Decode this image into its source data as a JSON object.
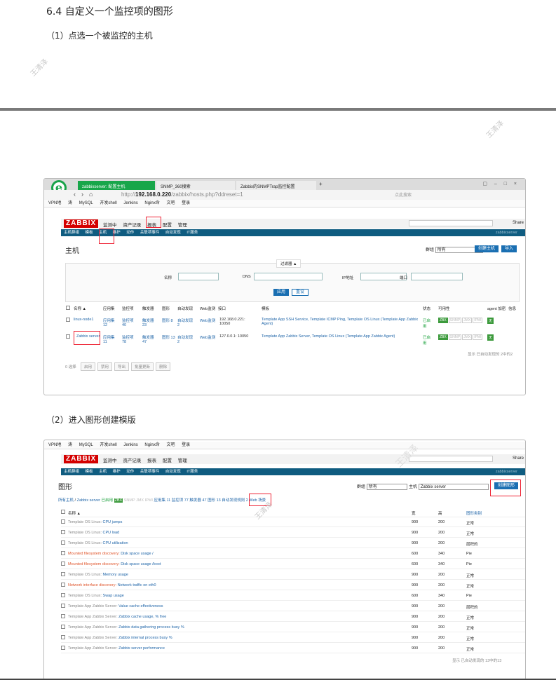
{
  "doc": {
    "heading": "6.4   自定义一个监控项的图形",
    "step1": "（1）点选一个被监控的主机",
    "step2": "（2）进入图形创建模版",
    "watermark": "王清泽"
  },
  "shot1": {
    "browser": {
      "tabs": [
        "zabbixserver: 配置主机",
        "SNMP_360搜索",
        "Zabbix的SNMPTrap监控配置"
      ],
      "url_prefix": "http://",
      "url_host": "192.168.0.220",
      "url_path": "/zabbix/hosts.php?ddreset=1",
      "search_placeholder": "点此搜索",
      "bookmarks": [
        "VPN地",
        "涛",
        "MySQL",
        "开发shell",
        "Jenkins",
        "Nginx命",
        "文吧",
        "登录"
      ]
    },
    "zabbix": {
      "logo": "ZABBIX",
      "menu": [
        "监测中",
        "资产记录",
        "报表",
        "配置",
        "管理"
      ],
      "share": "Share",
      "submenu": [
        "主机群组",
        "模板",
        "主机",
        "维护",
        "动作",
        "关联项事件",
        "自动发现",
        "IT服务"
      ],
      "server": "zabbixserver",
      "title": "主机",
      "group_label": "群组",
      "group_value": "所有",
      "create_btn": "创建主机",
      "import_btn": "导入",
      "filter": {
        "tab": "过滤器 ▲",
        "name": "名称",
        "dns": "DNS",
        "ip": "IP地址",
        "port": "端口",
        "apply": "应用",
        "reset": "重设"
      },
      "headers": [
        "名称 ▲",
        "应用集",
        "监控项",
        "触发器",
        "图形",
        "自动发现",
        "Web监测",
        "接口",
        "模板",
        "状态",
        "可用性",
        "agent 加密",
        "信息"
      ],
      "hosts": [
        {
          "name": "linux-node1",
          "apps": "应用集 12",
          "items": "监控项 40",
          "triggers": "触发器 23",
          "graphs": "图形 8",
          "disc": "自动发现 2",
          "web": "Web监测",
          "iface": "192.168.0.221: 10050",
          "templates": "Template App SSH Service, Template ICMP Ping, Template OS Linux (Template App Zabbix Agent)",
          "status": "已启用"
        },
        {
          "name": "Zabbix server",
          "apps": "应用集 11",
          "items": "监控项 78",
          "triggers": "触发器 47",
          "graphs": "图形 13",
          "disc": "自动发现 2",
          "web": "Web监测",
          "iface": "127.0.0.1: 10050",
          "templates": "Template App Zabbix Server, Template OS Linux (Template App Zabbix Agent)",
          "status": "已启用"
        }
      ],
      "avail": [
        "ZBX",
        "SNMP",
        "JMX",
        "IPMI"
      ],
      "enc": "无",
      "footer_note": "显示 已自动发现的 2中的2",
      "selected": "0 选择",
      "footer_btns": [
        "启用",
        "禁用",
        "导出",
        "批量更新",
        "删除"
      ]
    }
  },
  "shot2": {
    "bookmarks": [
      "VPN地",
      "涛",
      "MySQL",
      "开发shell",
      "Jenkins",
      "Nginx命",
      "文吧",
      "登录"
    ],
    "zabbix": {
      "logo": "ZABBIX",
      "menu": [
        "监测中",
        "资产记录",
        "报表",
        "配置",
        "管理"
      ],
      "share": "Share",
      "submenu": [
        "主机群组",
        "模板",
        "主机",
        "维护",
        "动作",
        "关联项事件",
        "自动发现",
        "IT服务"
      ],
      "server": "zabbixserver",
      "title": "图形",
      "group_label": "群组",
      "group_value": "所有",
      "host_label": "主机",
      "host_value": "Zabbix server",
      "create_btn": "创建图形",
      "breadcrumb": [
        "所有主机",
        "Zabbix server",
        "已启用",
        "ZBX",
        "应用集 11",
        "监控项 77",
        "触发器 47",
        "图形 13",
        "自动发现规则 2",
        "Web 场景"
      ],
      "headers": [
        "名称 ▲",
        "宽",
        "高",
        "图形类别"
      ],
      "graphs": [
        {
          "prefix": "Template OS Linux:",
          "name": "CPU jumps",
          "w": "900",
          "h": "200",
          "type": "正常",
          "red": false
        },
        {
          "prefix": "Template OS Linux:",
          "name": "CPU load",
          "w": "900",
          "h": "200",
          "type": "正常",
          "red": false
        },
        {
          "prefix": "Template OS Linux:",
          "name": "CPU utilization",
          "w": "900",
          "h": "200",
          "type": "层积的",
          "red": false
        },
        {
          "prefix": "Mounted filesystem discovery:",
          "name": "Disk space usage /",
          "w": "600",
          "h": "340",
          "type": "Pie",
          "red": true
        },
        {
          "prefix": "Mounted filesystem discovery:",
          "name": "Disk space usage /boot",
          "w": "600",
          "h": "340",
          "type": "Pie",
          "red": true
        },
        {
          "prefix": "Template OS Linux:",
          "name": "Memory usage",
          "w": "900",
          "h": "200",
          "type": "正常",
          "red": false
        },
        {
          "prefix": "Network interface discovery:",
          "name": "Network traffic on eth0",
          "w": "900",
          "h": "200",
          "type": "正常",
          "red": true
        },
        {
          "prefix": "Template OS Linux:",
          "name": "Swap usage",
          "w": "600",
          "h": "340",
          "type": "Pie",
          "red": false
        },
        {
          "prefix": "Template App Zabbix Server:",
          "name": "Value cache effectiveness",
          "w": "900",
          "h": "200",
          "type": "层积的",
          "red": false
        },
        {
          "prefix": "Template App Zabbix Server:",
          "name": "Zabbix cache usage, % free",
          "w": "900",
          "h": "200",
          "type": "正常",
          "red": false
        },
        {
          "prefix": "Template App Zabbix Server:",
          "name": "Zabbix data gathering process busy %",
          "w": "900",
          "h": "200",
          "type": "正常",
          "red": false
        },
        {
          "prefix": "Template App Zabbix Server:",
          "name": "Zabbix internal process busy %",
          "w": "900",
          "h": "200",
          "type": "正常",
          "red": false
        },
        {
          "prefix": "Template App Zabbix Server:",
          "name": "Zabbix server performance",
          "w": "900",
          "h": "200",
          "type": "正常",
          "red": false
        }
      ],
      "footer_note": "显示 已自动发现的 13中的13"
    }
  }
}
